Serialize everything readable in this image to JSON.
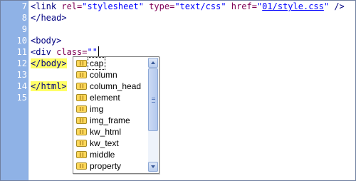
{
  "editor": {
    "line_numbers": [
      "7",
      "8",
      "9",
      "10",
      "11",
      "12",
      "13",
      "14",
      "15"
    ],
    "lines": {
      "l7": {
        "open": "<link ",
        "a1": "rel=",
        "v1": "\"stylesheet\"",
        "a2": " type=",
        "v2": "\"text/css\"",
        "a3": " href=",
        "v3q1": "\"",
        "v3link": "01/style.css",
        "v3q2": "\"",
        "close": " />"
      },
      "l8": {
        "text": "</head>"
      },
      "l10": {
        "text": "<body>"
      },
      "l11": {
        "open": "<div ",
        "attr": "class=",
        "val": "\"\""
      },
      "l12": {
        "text": "</body>"
      },
      "l14": {
        "text": "</html>"
      }
    }
  },
  "autocomplete": {
    "items": [
      "cap",
      "column",
      "column_head",
      "element",
      "img",
      "img_frame",
      "kw_html",
      "kw_text",
      "middle",
      "property"
    ],
    "selected_index": 0,
    "icon": "tag-icon",
    "scroll_position": 0.0
  }
}
